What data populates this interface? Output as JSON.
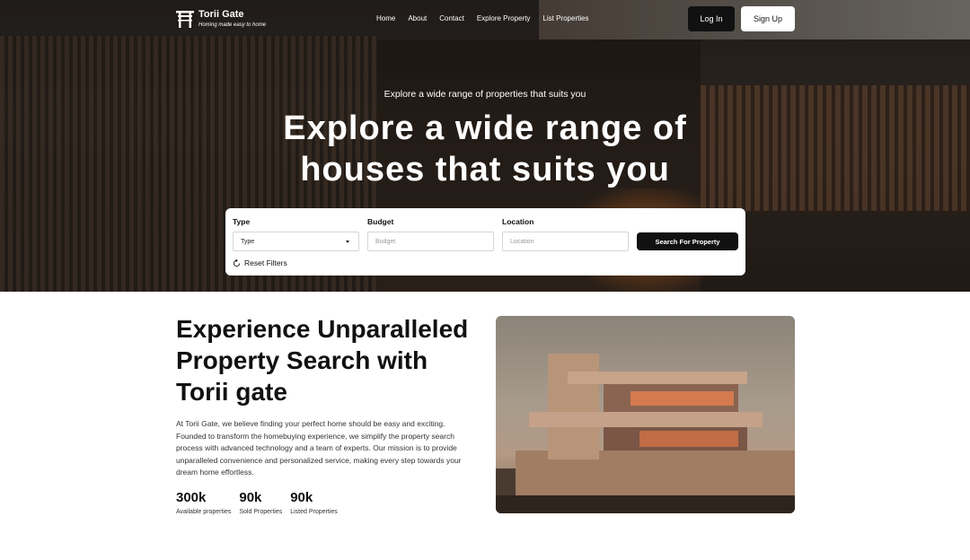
{
  "brand": {
    "name": "Torii Gate",
    "tagline": "Homing made easy to home"
  },
  "nav": {
    "links": [
      "Home",
      "About",
      "Contact",
      "Explore Property",
      "List Properties"
    ],
    "login": "Log In",
    "signup": "Sign Up"
  },
  "hero": {
    "eyebrow": "Explore a wide range of properties that suits you",
    "title": "Explore a wide range of houses that suits you"
  },
  "filter": {
    "type_label": "Type",
    "type_value": "Type",
    "budget_label": "Budget",
    "budget_placeholder": "Budget",
    "location_label": "Location",
    "location_placeholder": "Location",
    "search_button": "Search For Property",
    "reset": "Reset Filters"
  },
  "about": {
    "title": "Experience Unparalleled Property Search with Torii gate",
    "text": "At Torii Gate, we believe finding your perfect home should be easy and exciting. Founded to transform the homebuying experience, we simplify the property search process with advanced technology and a team of experts. Our mission is to provide unparalleled convenience and personalized service, making every step towards your dream home effortless."
  },
  "stats": [
    {
      "value": "300k",
      "label": "Available properties"
    },
    {
      "value": "90k",
      "label": "Sold Properties"
    },
    {
      "value": "90k",
      "label": "Listed Properties"
    }
  ],
  "colors": {
    "dark": "#111111",
    "white": "#ffffff"
  }
}
